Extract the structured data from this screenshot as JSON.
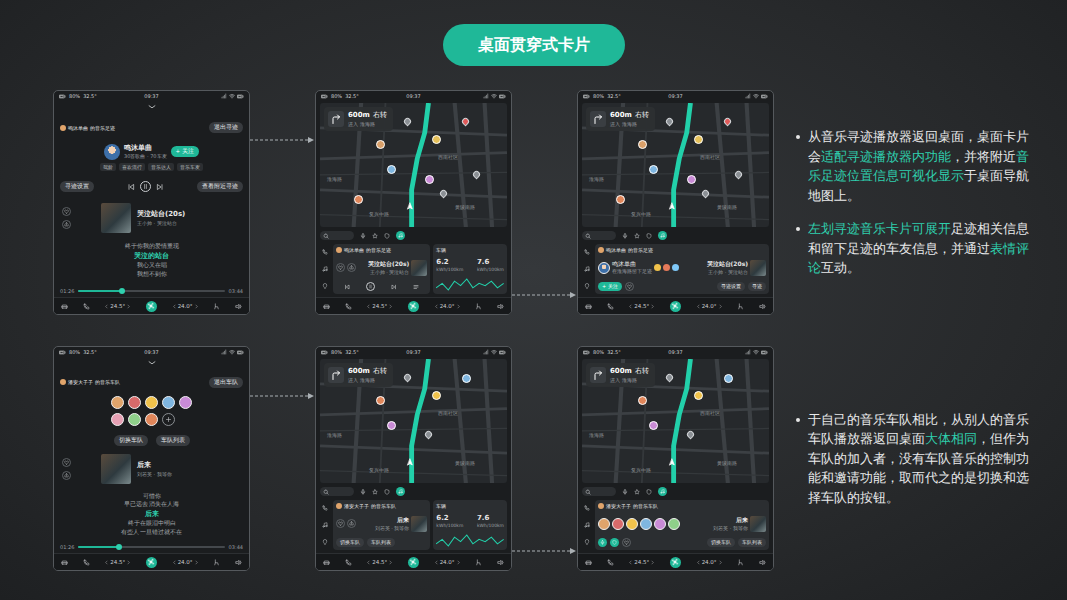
{
  "title": "桌面贯穿式卡片",
  "rows": [
    {
      "screens": [
        {
          "kind": "player",
          "status": {
            "battery": "80%",
            "temp": "32.5°",
            "time": "09:37"
          },
          "header": {
            "title": "鸣沐单曲 的音乐足迹",
            "exit": "退出寻迹"
          },
          "profile": {
            "name": "鸣沐单曲",
            "sub": "30首歌曲 · 70车友",
            "follow": "+ 关注",
            "tags": [
              "驾龄",
              "喜欢流行",
              "音乐达人",
              "音乐车友"
            ]
          },
          "controls": {
            "left": "寻迹设置",
            "right": "查看附近寻迹"
          },
          "song": {
            "title": "哭泣站台(20s)",
            "artist": "王小帅 · 哭泣站台"
          },
          "lyrics": [
            {
              "text": "终于你我的爱情重现",
              "current": false
            },
            {
              "text": "哭泣的站台",
              "current": true
            },
            {
              "text": "我心又在唱",
              "current": false
            },
            {
              "text": "我想不到你",
              "current": false
            }
          ],
          "progress": {
            "level": 0.3,
            "start": "01:26",
            "end": "03:44"
          },
          "dock": {
            "left": "24.5°",
            "right": "24.0°"
          }
        },
        {
          "kind": "map",
          "status": {
            "battery": "80%",
            "temp": "32.5°",
            "time": "09:37"
          },
          "nav": {
            "distance": "600m",
            "action": "右转",
            "road": "进入 淮海路"
          },
          "labels": [
            "淮海路",
            "西南社区",
            "复兴中路",
            "黄陂南路"
          ],
          "pins": [
            {
              "kind": "avatar",
              "color": "#d9a06a"
            },
            {
              "kind": "marker",
              "color": "#8a8f94"
            },
            {
              "kind": "avatar",
              "color": "#e6c15a"
            },
            {
              "kind": "marker",
              "color": "#e05a5a"
            },
            {
              "kind": "avatar",
              "color": "#7fb6e0"
            },
            {
              "kind": "avatar",
              "color": "#c98bd6"
            },
            {
              "kind": "marker",
              "color": "#8a8f94"
            },
            {
              "kind": "avatar",
              "color": "#e0865a"
            },
            {
              "kind": "marker",
              "color": "#8a8f94"
            }
          ],
          "card": {
            "owner": "鸣沐单曲 的音乐足迹",
            "song": {
              "title": "哭泣站台(20s)",
              "artist": "王小帅 · 哭泣站台"
            }
          },
          "vehicle": {
            "title": "车辆",
            "stats": [
              {
                "value": "6.2",
                "unit": "kWh/100km"
              },
              {
                "value": "7.6",
                "unit": "kWh/100km"
              }
            ],
            "series": [
              5,
              7,
              4,
              8,
              6,
              9,
              5,
              7,
              6,
              8,
              5,
              7
            ]
          },
          "dock": {
            "left": "24.5°",
            "right": "24.0°"
          }
        },
        {
          "kind": "map-expanded",
          "status": {
            "battery": "80%",
            "temp": "32.5°",
            "time": "09:37"
          },
          "nav": {
            "distance": "600m",
            "action": "右转",
            "road": "进入 淮海路"
          },
          "labels": [
            "淮海路",
            "西南社区",
            "复兴中路",
            "黄陂南路"
          ],
          "pins": [
            {
              "kind": "avatar",
              "color": "#d9a06a"
            },
            {
              "kind": "marker",
              "color": "#8a8f94"
            },
            {
              "kind": "avatar",
              "color": "#e6c15a"
            },
            {
              "kind": "marker",
              "color": "#e05a5a"
            },
            {
              "kind": "avatar",
              "color": "#7fb6e0"
            },
            {
              "kind": "avatar",
              "color": "#c98bd6"
            },
            {
              "kind": "marker",
              "color": "#8a8f94"
            },
            {
              "kind": "avatar",
              "color": "#e0865a"
            },
            {
              "kind": "marker",
              "color": "#8a8f94"
            }
          ],
          "card": {
            "owner": "鸣沐单曲 的音乐足迹",
            "footprint": {
              "name": "鸣沐单曲",
              "sub": "在淮海路留下足迹",
              "reactions": [
                {
                  "color": "#f0c24b"
                },
                {
                  "color": "#e57a5a"
                },
                {
                  "color": "#7fc8f8"
                }
              ]
            },
            "song": {
              "title": "哭泣站台(20s)",
              "artist": "王小帅 · 哭泣站台"
            },
            "follow": "+ 关注",
            "buttons": [
              "寻迹设置",
              "寻迹"
            ]
          },
          "dock": {
            "left": "24.5°",
            "right": "24.0°"
          }
        }
      ],
      "notes": [
        {
          "segments": [
            {
              "text": "从音乐寻迹播放器返回桌面，桌面卡片会",
              "highlight": false
            },
            {
              "text": "适配寻迹播放器内功能",
              "highlight": true
            },
            {
              "text": "，并将附近",
              "highlight": false
            },
            {
              "text": "音乐足迹位置信息可视化显示",
              "highlight": true
            },
            {
              "text": "于桌面导航地图上。",
              "highlight": false
            }
          ]
        },
        {
          "segments": [
            {
              "text": "左划寻迹音乐卡片可展开",
              "highlight": true
            },
            {
              "text": "足迹相关信息和留下足迹的车友信息，并通过",
              "highlight": false
            },
            {
              "text": "表情评论",
              "highlight": true
            },
            {
              "text": "互动。",
              "highlight": false
            }
          ]
        }
      ]
    },
    {
      "screens": [
        {
          "kind": "player",
          "status": {
            "battery": "80%",
            "temp": "32.5°",
            "time": "09:37"
          },
          "header": {
            "title": "潘安大子子 的音乐车队",
            "exit": "退出车队"
          },
          "members": [
            {
              "color": "#e0a46b"
            },
            {
              "color": "#d86a6a"
            },
            {
              "color": "#f0c24b"
            },
            {
              "color": "#7fb6e0"
            },
            {
              "color": "#c98bd6"
            },
            {
              "color": "#e6a0b4"
            },
            {
              "color": "#8fd08a"
            },
            {
              "color": "#e0865a"
            }
          ],
          "teamButtons": [
            "切换车队",
            "车队列表"
          ],
          "song": {
            "title": "后来",
            "artist": "刘若英 · 我等你"
          },
          "lyrics": [
            {
              "text": "可惜你",
              "current": false
            },
            {
              "text": "早已远去 消失在人海",
              "current": false
            },
            {
              "text": "后来",
              "current": true
            },
            {
              "text": "终于在眼泪中明白",
              "current": false
            },
            {
              "text": "有些人 一旦错过就不在",
              "current": false
            }
          ],
          "progress": {
            "level": 0.28,
            "start": "01:26",
            "end": "03:44"
          },
          "dock": {
            "left": "24.5°",
            "right": "24.0°"
          }
        },
        {
          "kind": "map",
          "status": {
            "battery": "80%",
            "temp": "32.5°",
            "time": "09:37"
          },
          "nav": {
            "distance": "600m",
            "action": "右转",
            "road": "进入 淮海路"
          },
          "labels": [
            "淮海路",
            "西南社区",
            "复兴中路",
            "黄陂南路"
          ],
          "pins": [
            {
              "kind": "avatar",
              "color": "#e0865a"
            },
            {
              "kind": "marker",
              "color": "#8a8f94"
            },
            {
              "kind": "avatar",
              "color": "#f0c24b"
            },
            {
              "kind": "avatar",
              "color": "#7fb6e0"
            },
            {
              "kind": "avatar",
              "color": "#c98bd6"
            },
            {
              "kind": "marker",
              "color": "#8a8f94"
            }
          ],
          "card": {
            "owner": "潘安大子子 的音乐车队",
            "song": {
              "title": "后来",
              "artist": "刘若英 · 我等你"
            },
            "buttons": [
              "切换车队",
              "车队列表"
            ]
          },
          "vehicle": {
            "title": "车辆",
            "stats": [
              {
                "value": "6.2",
                "unit": "kWh/100km"
              },
              {
                "value": "7.6",
                "unit": "kWh/100km"
              }
            ],
            "series": [
              5,
              7,
              4,
              8,
              6,
              9,
              5,
              7,
              6,
              8,
              5,
              7
            ]
          },
          "dock": {
            "left": "24.5°",
            "right": "24.0°"
          }
        },
        {
          "kind": "map-expanded",
          "status": {
            "battery": "80%",
            "temp": "32.5°",
            "time": "09:37"
          },
          "nav": {
            "distance": "600m",
            "action": "右转",
            "road": "进入 淮海路"
          },
          "labels": [
            "淮海路",
            "西南社区",
            "复兴中路",
            "黄陂南路"
          ],
          "pins": [
            {
              "kind": "avatar",
              "color": "#e0865a"
            },
            {
              "kind": "marker",
              "color": "#8a8f94"
            },
            {
              "kind": "avatar",
              "color": "#f0c24b"
            },
            {
              "kind": "avatar",
              "color": "#7fb6e0"
            },
            {
              "kind": "avatar",
              "color": "#c98bd6"
            },
            {
              "kind": "marker",
              "color": "#8a8f94"
            }
          ],
          "card": {
            "owner": "潘安大子子 的音乐车队",
            "members": [
              {
                "color": "#e0a46b"
              },
              {
                "color": "#d86a6a"
              },
              {
                "color": "#f0c24b"
              },
              {
                "color": "#7fb6e0"
              },
              {
                "color": "#c98bd6"
              },
              {
                "color": "#8fd08a"
              }
            ],
            "song": {
              "title": "后来",
              "artist": "刘若英 · 我等你"
            },
            "buttons": [
              "切换车队",
              "车队列表"
            ]
          },
          "dock": {
            "left": "24.5°",
            "right": "24.0°"
          }
        }
      ],
      "notes": [
        {
          "segments": [
            {
              "text": "于自己的音乐车队相比，从别人的音乐车队播放器返回桌面",
              "highlight": false
            },
            {
              "text": "大体相同",
              "highlight": true
            },
            {
              "text": "，但作为车队的加入者，没有车队音乐的控制功能和邀请功能，取而代之的是切换和选择车队的按钮。",
              "highlight": false
            }
          ]
        }
      ]
    }
  ]
}
